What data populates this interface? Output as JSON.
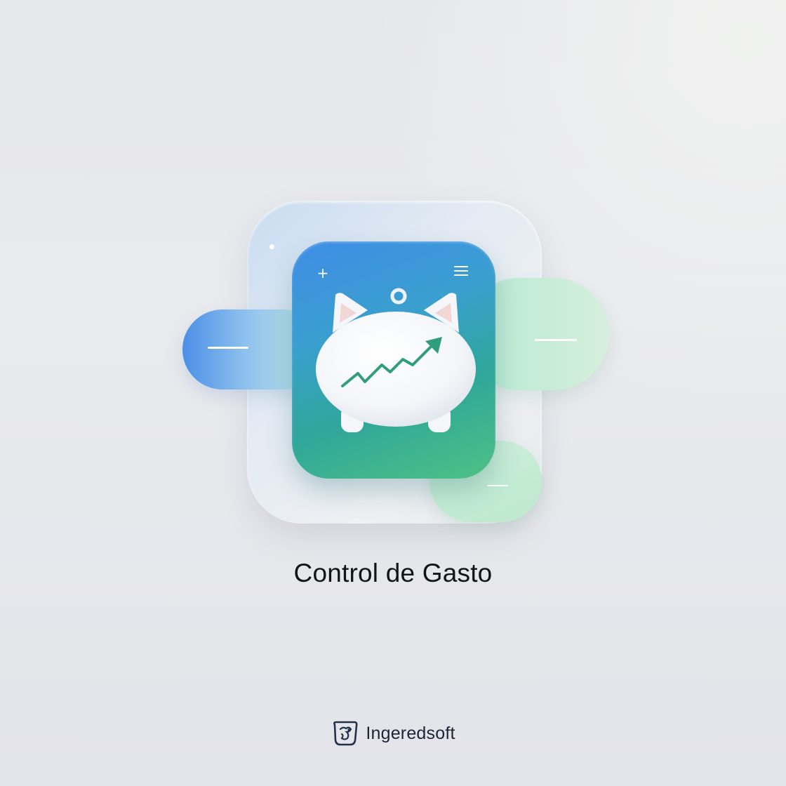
{
  "title": "Control de Gasto",
  "brand": {
    "name": "Ingeredsoft",
    "logo_icon": "brand-logo-icon"
  },
  "icons": {
    "top_left": "plus-icon",
    "top_right": "menu-icon",
    "center": "piggy-bank-growth-icon"
  },
  "colors": {
    "background": "#e6e7eb",
    "card_gradient_start": "#3f8de6",
    "card_gradient_end": "#4fc184",
    "trend_arrow": "#2f9e7a",
    "title_text": "#111418",
    "brand_text": "#1c2536"
  }
}
